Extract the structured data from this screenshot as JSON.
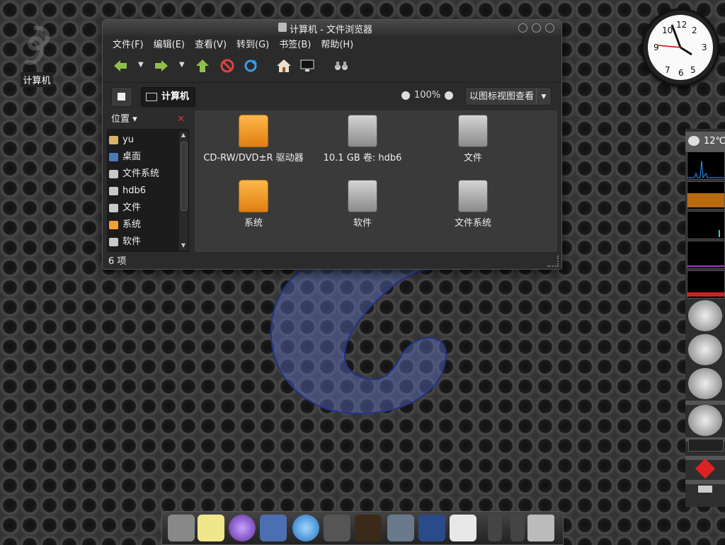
{
  "desktop": {
    "computer_label": "计算机"
  },
  "window": {
    "title": "计算机 - 文件浏览器",
    "menu": [
      "文件(F)",
      "编辑(E)",
      "查看(V)",
      "转到(G)",
      "书签(B)",
      "帮助(H)"
    ],
    "location": {
      "crumb": "计算机",
      "zoom": "100%",
      "view": "以图标视图查看"
    },
    "sidebar": {
      "header": "位置 ▾",
      "items": [
        {
          "label": "yu",
          "icon": "home-icon",
          "color": "#d9b36a"
        },
        {
          "label": "桌面",
          "icon": "desktop-icon",
          "color": "#4a7ab8"
        },
        {
          "label": "文件系统",
          "icon": "drive-icon",
          "color": "#c8c8c8"
        },
        {
          "label": "hdb6",
          "icon": "drive-icon",
          "color": "#c8c8c8"
        },
        {
          "label": "文件",
          "icon": "drive-icon",
          "color": "#c8c8c8"
        },
        {
          "label": "系统",
          "icon": "drive-icon",
          "color": "#f5a030"
        },
        {
          "label": "软件",
          "icon": "drive-icon",
          "color": "#c8c8c8"
        }
      ]
    },
    "files": [
      {
        "label": "CD-RW/DVD±R 驱动器",
        "kind": "orange"
      },
      {
        "label": "10.1 GB 卷: hdb6",
        "kind": "grey"
      },
      {
        "label": "文件",
        "kind": "grey"
      },
      {
        "label": "系统",
        "kind": "orange"
      },
      {
        "label": "软件",
        "kind": "grey"
      },
      {
        "label": "文件系统",
        "kind": "grey"
      }
    ],
    "status": "6 项"
  },
  "panel": {
    "temperature": "12℃"
  }
}
